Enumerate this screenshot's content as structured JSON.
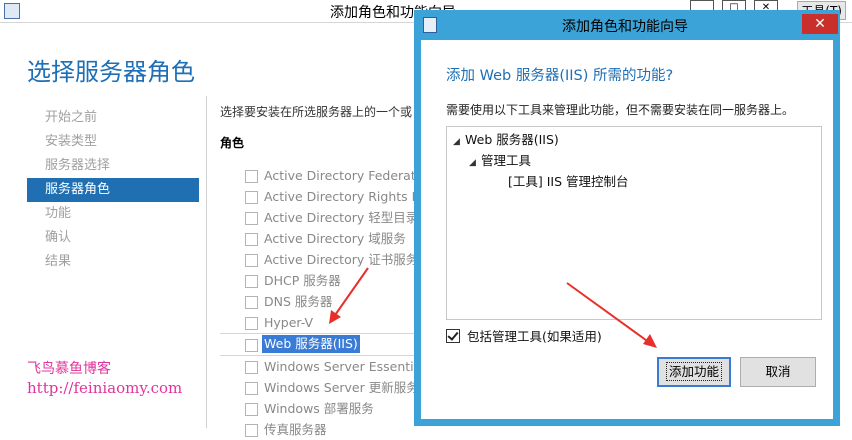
{
  "background_window": {
    "title": "添加角色和功能向导",
    "top_right_label": "工具(T)",
    "page_heading": "选择服务器角色",
    "nav": [
      {
        "label": "开始之前",
        "active": false
      },
      {
        "label": "安装类型",
        "active": false
      },
      {
        "label": "服务器选择",
        "active": false
      },
      {
        "label": "服务器角色",
        "active": true
      },
      {
        "label": "功能",
        "active": false
      },
      {
        "label": "确认",
        "active": false
      },
      {
        "label": "结果",
        "active": false
      }
    ],
    "description": "选择要安装在所选服务器上的一个或",
    "roles_label": "角色",
    "roles": [
      {
        "label": "Active Directory Federation"
      },
      {
        "label": "Active Directory Rights Ma"
      },
      {
        "label": "Active Directory 轻型目录服"
      },
      {
        "label": "Active Directory 域服务"
      },
      {
        "label": "Active Directory 证书服务"
      },
      {
        "label": "DHCP 服务器"
      },
      {
        "label": "DNS 服务器"
      },
      {
        "label": "Hyper-V"
      },
      {
        "label": "Web 服务器(IIS)",
        "selected": true
      },
      {
        "label": "Windows Server Essentials"
      },
      {
        "label": "Windows Server 更新服务"
      },
      {
        "label": "Windows 部署服务"
      },
      {
        "label": "传真服务器"
      }
    ]
  },
  "watermark": {
    "name": "飞鸟慕鱼博客",
    "url": "http://feiniaomy.com"
  },
  "dialog": {
    "title": "添加角色和功能向导",
    "close_glyph": "✕",
    "heading": "添加 Web 服务器(IIS) 所需的功能?",
    "description": "需要使用以下工具来管理此功能，但不需要安装在同一服务器上。",
    "tree": {
      "root": "Web 服务器(IIS)",
      "child": "管理工具",
      "leaf": "[工具] IIS 管理控制台"
    },
    "include_tools_label": "包括管理工具(如果适用)",
    "include_tools_checked": true,
    "add_button": "添加功能",
    "cancel_button": "取消"
  },
  "colors": {
    "accent_blue": "#1e6fb5",
    "dialog_border": "#3ba3d8",
    "nav_active": "#1f6fb2",
    "watermark": "#e0349c",
    "annotation_arrow": "#e8302a"
  }
}
